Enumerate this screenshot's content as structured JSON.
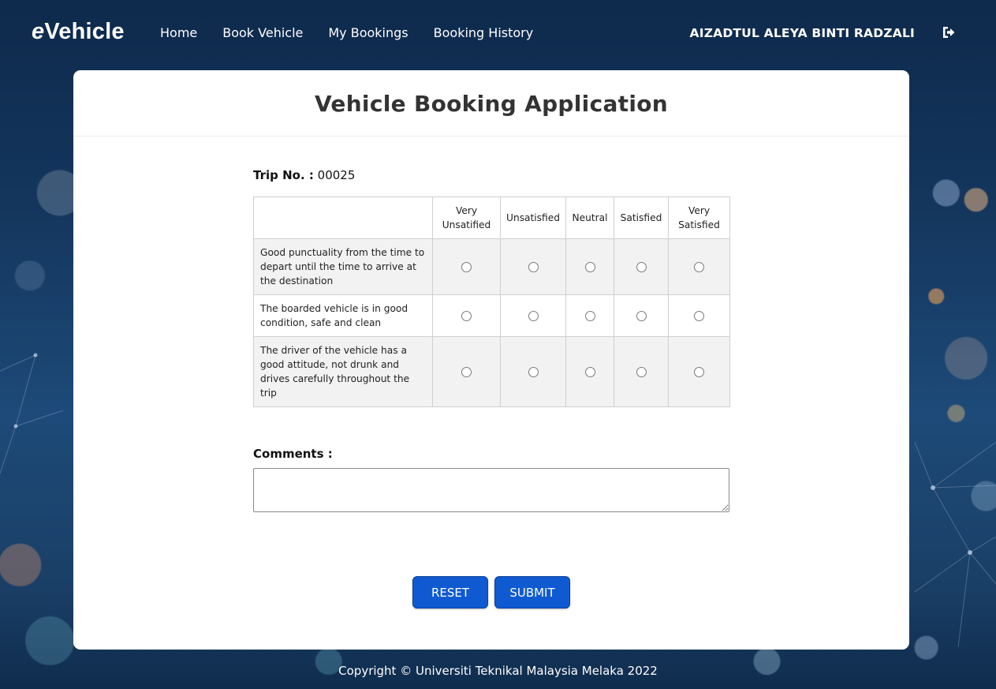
{
  "app": {
    "logo_prefix": "e",
    "logo_rest": "Vehicle"
  },
  "nav": {
    "items": [
      {
        "label": "Home"
      },
      {
        "label": "Book Vehicle"
      },
      {
        "label": "My Bookings"
      },
      {
        "label": "Booking History"
      }
    ],
    "user_name": "AIZADTUL ALEYA BINTI RADZALI",
    "logout_icon": "sign-out-icon"
  },
  "page": {
    "title": "Vehicle Booking Application",
    "trip_label": "Trip No. :",
    "trip_value": "00025"
  },
  "survey": {
    "columns": [
      {
        "line1": "Very",
        "line2": "Unsatified"
      },
      {
        "line1": "Unsatisfied",
        "line2": ""
      },
      {
        "line1": "Neutral",
        "line2": ""
      },
      {
        "line1": "Satisfied",
        "line2": ""
      },
      {
        "line1": "Very",
        "line2": "Satisfied"
      }
    ],
    "questions": [
      {
        "text": "Good punctuality from the time to depart until the time to arrive at the destination"
      },
      {
        "text": "The boarded vehicle is in good condition, safe and clean"
      },
      {
        "text": "The driver of the vehicle has a good attitude, not drunk and drives carefully throughout the trip"
      }
    ]
  },
  "comments": {
    "label": "Comments :",
    "value": ""
  },
  "buttons": {
    "reset": "RESET",
    "submit": "SUBMIT"
  },
  "footer": {
    "text": "Copyright © Universiti Teknikal Malaysia Melaka 2022"
  },
  "colors": {
    "button_bg": "#0f5ad1",
    "title": "#333333"
  }
}
